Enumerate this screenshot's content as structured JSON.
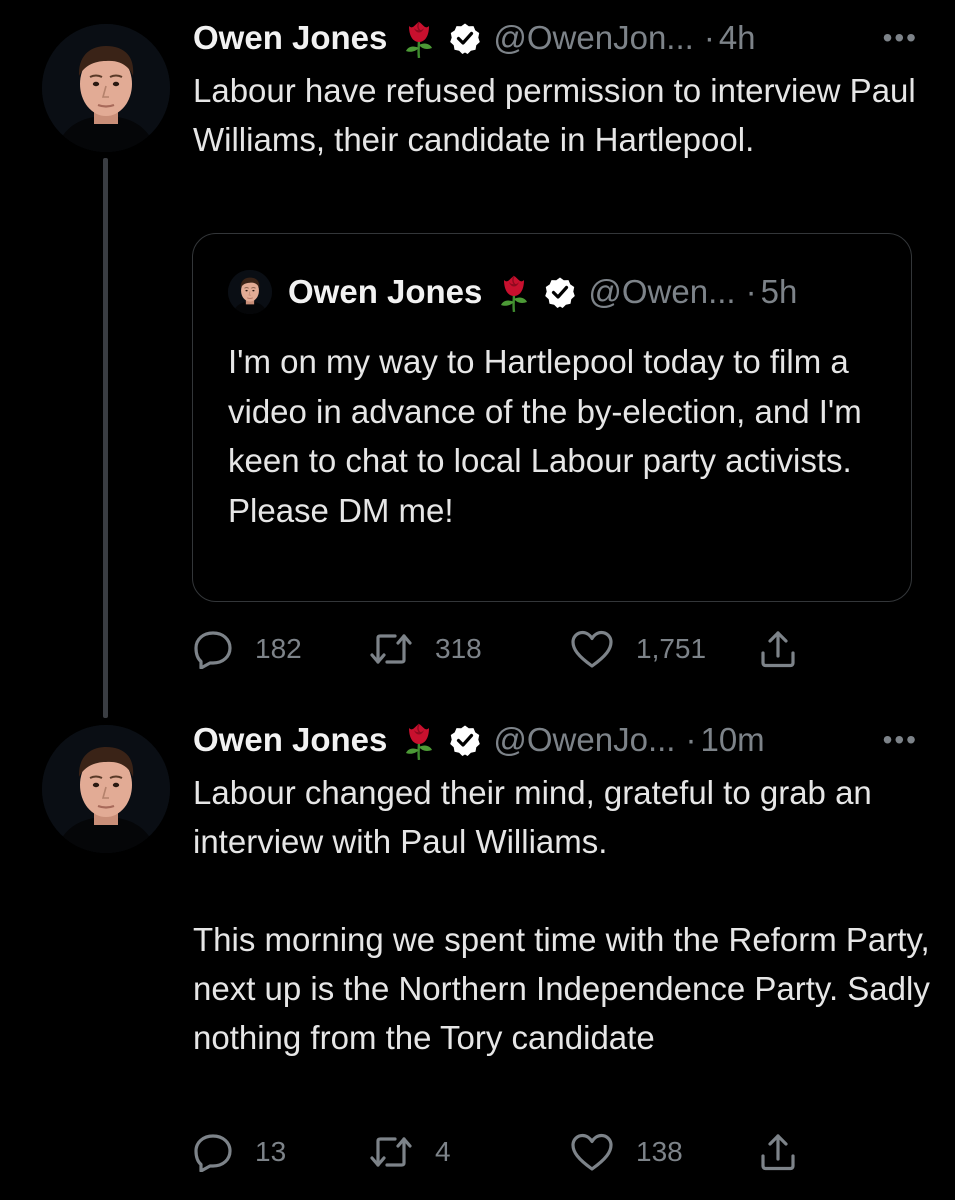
{
  "tweets": [
    {
      "author": "Owen Jones",
      "handle": "@OwenJon...",
      "time": "4h",
      "text": "Labour have refused permission to interview Paul Williams, their candidate in Hartlepool.",
      "quoted": {
        "author": "Owen Jones",
        "handle": "@Owen...",
        "time": "5h",
        "text": "I'm on my way to Hartlepool today to film a video in advance of the by-election, and I'm keen to chat to local Labour party activists. Please DM me!"
      },
      "replies": "182",
      "retweets": "318",
      "likes": "1,751"
    },
    {
      "author": "Owen Jones",
      "handle": "@OwenJo...",
      "time": "10m",
      "text": "Labour changed their mind, grateful to grab an interview with Paul Williams.\n\nThis morning we spent time with the Reform Party, next up is the Northern Independence Party. Sadly nothing from the Tory candidate",
      "replies": "13",
      "retweets": "4",
      "likes": "138"
    }
  ],
  "ui": {
    "separator": "·",
    "more": "•••",
    "icons": [
      "rose-emoji-icon",
      "verified-badge-icon",
      "reply-icon",
      "retweet-icon",
      "like-icon",
      "share-icon",
      "more-icon"
    ],
    "colors": {
      "background": "#000000",
      "muted": "#7d8389",
      "text": "#e6e6e6",
      "rose": "#c8102e"
    }
  }
}
